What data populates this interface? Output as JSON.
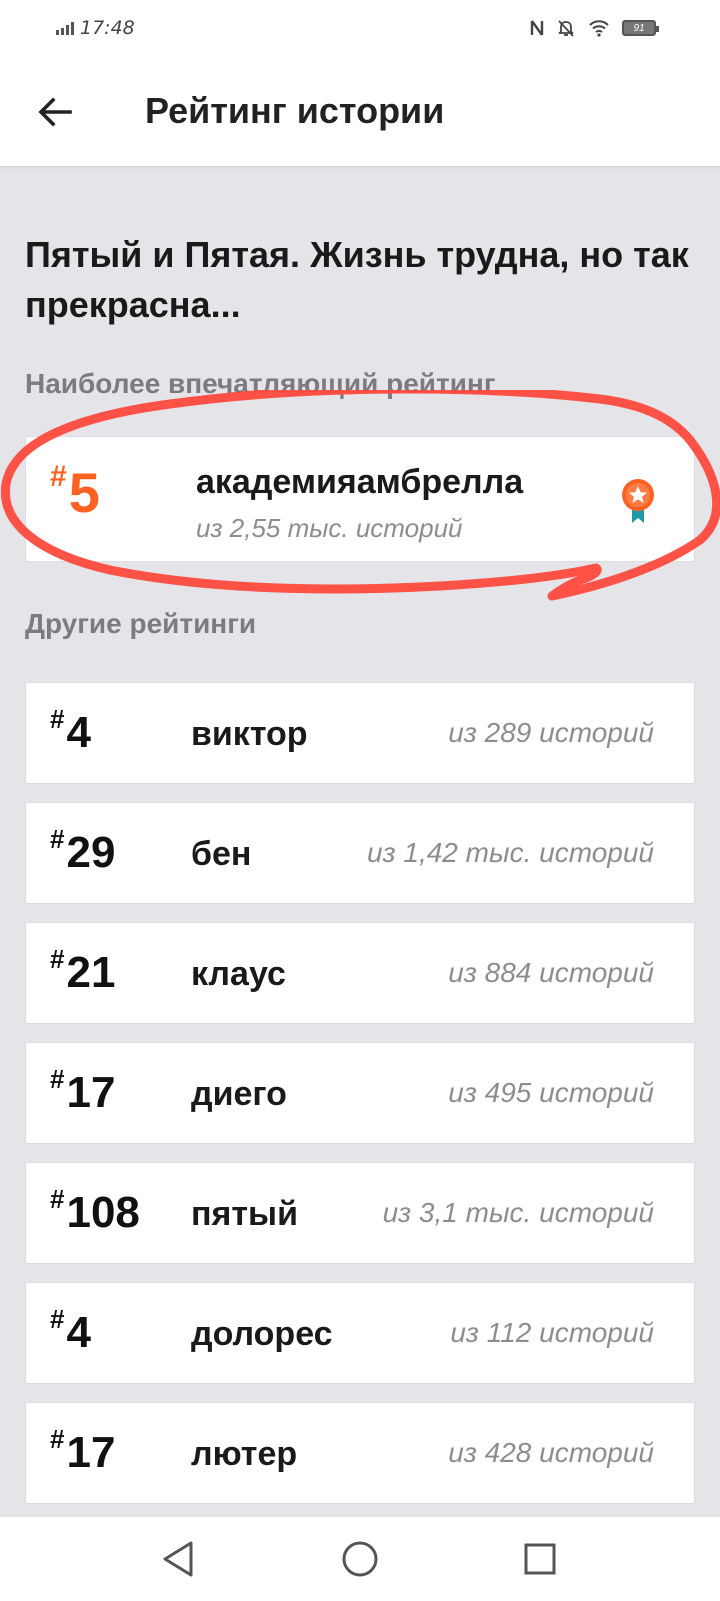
{
  "status_bar": {
    "time": "17:48",
    "battery": "91",
    "icons": [
      "signal-icon",
      "nfc-icon",
      "mute-icon",
      "wifi-icon",
      "battery-icon"
    ]
  },
  "header": {
    "title": "Рейтинг истории",
    "back_icon": "arrow-left-icon"
  },
  "story": {
    "title": "Пятый и Пятая. Жизнь трудна, но так прекрасна..."
  },
  "featured": {
    "label": "Наиболее впечатляющий рейтинг",
    "hash": "#",
    "rank": "5",
    "tag": "академияамбрелла",
    "total": "из 2,55 тыс. историй",
    "icon": "award-medal-icon",
    "accent_color": "#ff6122",
    "annotation_color": "#ff4a3d"
  },
  "others": {
    "label": "Другие рейтинги",
    "items": [
      {
        "hash": "#",
        "rank": "4",
        "tag": "виктор",
        "total": "из 289 историй"
      },
      {
        "hash": "#",
        "rank": "29",
        "tag": "бен",
        "total": "из 1,42 тыс. историй"
      },
      {
        "hash": "#",
        "rank": "21",
        "tag": "клаус",
        "total": "из 884 историй"
      },
      {
        "hash": "#",
        "rank": "17",
        "tag": "диего",
        "total": "из 495 историй"
      },
      {
        "hash": "#",
        "rank": "108",
        "tag": "пятый",
        "total": "из 3,1 тыс. историй"
      },
      {
        "hash": "#",
        "rank": "4",
        "tag": "долорес",
        "total": "из 112 историй"
      },
      {
        "hash": "#",
        "rank": "17",
        "tag": "лютер",
        "total": "из 428 историй"
      }
    ]
  },
  "nav_bar": {
    "icons": [
      "back-triangle-icon",
      "home-circle-icon",
      "recents-square-icon"
    ]
  }
}
